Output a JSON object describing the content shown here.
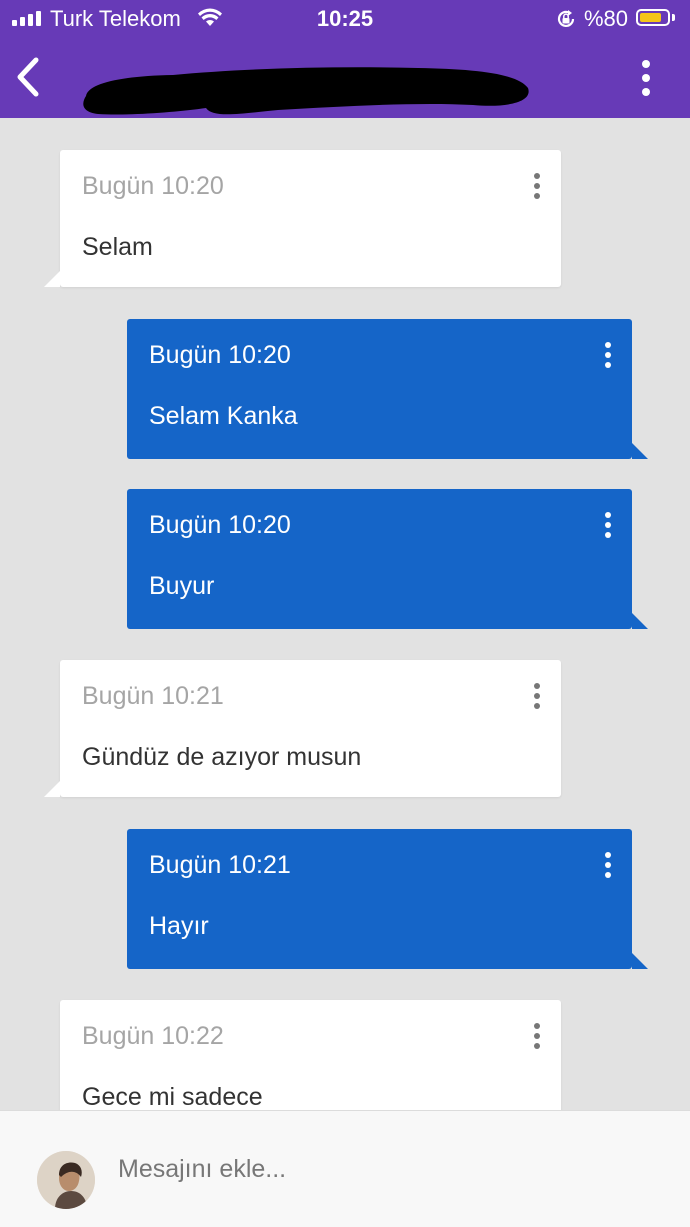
{
  "status_bar": {
    "carrier": "Turk Telekom",
    "time": "10:25",
    "battery_percent": "%80",
    "battery_level": 0.8,
    "icons": [
      "signal-icon",
      "wifi-icon",
      "orientation-lock-icon",
      "battery-icon"
    ]
  },
  "app_bar": {
    "title": "",
    "icons": [
      "back-arrow-icon",
      "more-vertical-icon"
    ]
  },
  "colors": {
    "accent": "#673ab7",
    "outgoing_bubble": "#1565c8",
    "incoming_bubble": "#ffffff",
    "background": "#e2e2e2",
    "battery": "#f5c518"
  },
  "messages": [
    {
      "direction": "incoming",
      "time": "Bugün 10:20",
      "text": "Selam"
    },
    {
      "direction": "outgoing",
      "time": "Bugün 10:20",
      "text": "Selam Kanka"
    },
    {
      "direction": "outgoing",
      "time": "Bugün 10:20",
      "text": "Buyur"
    },
    {
      "direction": "incoming",
      "time": "Bugün 10:21",
      "text": "Gündüz de azıyor musun"
    },
    {
      "direction": "outgoing",
      "time": "Bugün 10:21",
      "text": "Hayır"
    },
    {
      "direction": "incoming",
      "time": "Bugün 10:22",
      "text": "Gece mi sadece"
    }
  ],
  "composer": {
    "placeholder": "Mesajını ekle...",
    "value": ""
  }
}
